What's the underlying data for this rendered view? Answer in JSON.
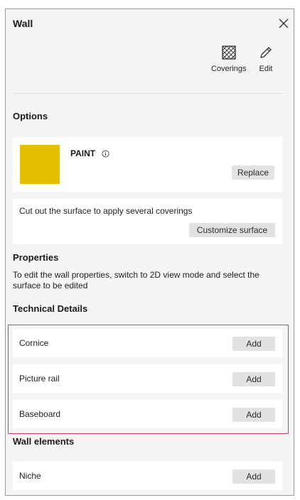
{
  "panel": {
    "title": "Wall",
    "toolbar": {
      "coverings_label": "Coverings",
      "edit_label": "Edit"
    }
  },
  "options": {
    "heading": "Options",
    "paint": {
      "name": "PAINT",
      "swatch_color": "#e5bf00",
      "replace_label": "Replace"
    },
    "customize": {
      "text": "Cut out the surface to apply several coverings",
      "button_label": "Customize surface"
    }
  },
  "properties": {
    "heading": "Properties",
    "text": "To edit the wall properties, switch to 2D view mode and select the surface to be edited"
  },
  "technical_details": {
    "heading": "Technical Details",
    "items": [
      {
        "label": "Cornice",
        "action": "Add"
      },
      {
        "label": "Picture rail",
        "action": "Add"
      },
      {
        "label": "Baseboard",
        "action": "Add"
      }
    ]
  },
  "wall_elements": {
    "heading": "Wall elements",
    "items": [
      {
        "label": "Niche",
        "action": "Add"
      }
    ]
  },
  "colors": {
    "highlight_border": "#d9424a",
    "panel_bg": "#f5f5f5",
    "button_bg": "#e2e2e2"
  },
  "icons": {
    "close": "close-icon",
    "coverings": "coverings-hatch-icon",
    "edit": "pencil-icon",
    "info": "info-icon"
  }
}
